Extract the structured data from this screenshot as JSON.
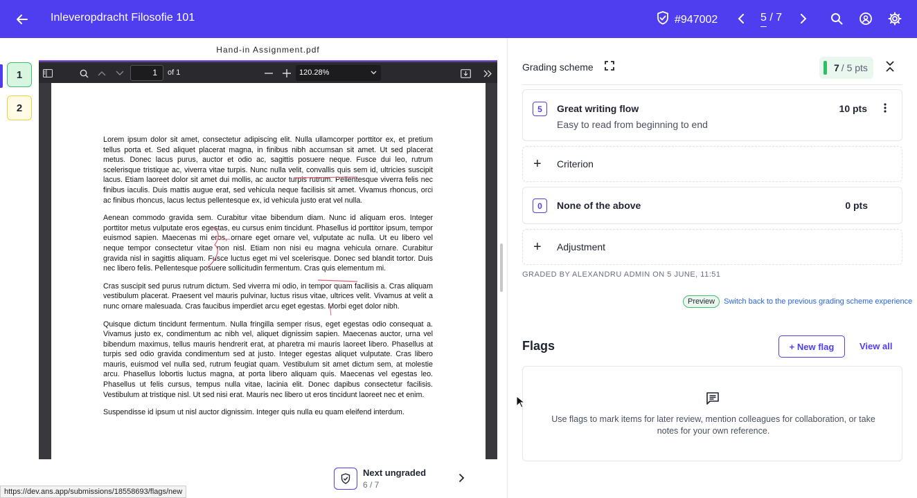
{
  "header": {
    "title": "Inleveropdracht Filosofie 101",
    "submission_id": "#947002",
    "counter_current": "5",
    "counter_total": "/ 7"
  },
  "pages": [
    {
      "label": "1"
    },
    {
      "label": "2"
    }
  ],
  "pdf": {
    "filename": "Hand-in Assignment.pdf",
    "page_number": "1",
    "of_pages": "of 1",
    "zoom": "120.28%",
    "paragraphs": [
      "Lorem ipsum dolor sit amet, consectetur adipiscing elit. Nulla ullamcorper porttitor ex, et pretium tellus porta et. Sed aliquet placerat magna, in finibus nibh accumsan sit amet. Ut sed placerat metus. Donec lacus purus, auctor et odio ac, sagittis posuere neque. Fusce dui leo, rutrum scelerisque tristique ac, viverra vitae turpis. Nunc nulla velit, convallis quis sem id, ultricies suscipit lacus. Etiam laoreet dolor sit amet dui mollis, ac auctor turpis rutrum. Pellentesque viverra felis nec finibus iaculis. Duis mattis augue erat, sed vehicula neque facilisis sit amet. Vivamus rhoncus, orci ac finibus rhoncus, lacus lectus pellentesque ex, id vehicula justo erat vel nulla.",
      "Aenean commodo gravida sem. Curabitur vitae bibendum diam. Nunc id aliquam eros. Integer porttitor metus vulputate eros egestas, eu cursus enim tincidunt. Phasellus id porttitor ipsum, tempor euismod sapien. Maecenas mi eros, ornare eget ornare vel, vulputate ac nulla. Ut eu libero vel neque tempor consectetur vitae non nisl. Etiam non nisi eu magna vehicula ornare. Curabitur gravida nisl in sagittis aliquam. Fusce luctus eget mi vel scelerisque. Donec sed blandit tortor. Duis nec libero felis. Pellentesque posuere sollicitudin fermentum. Cras quis elementum mi.",
      "Cras suscipit sed purus rutrum dictum. Sed viverra mi odio, in tempor quam facilisis a. Cras aliquam vestibulum placerat. Praesent vel mauris pulvinar, luctus risus vitae, ultrices velit. Vivamus at velit a nunc ornare malesuada. Cras faucibus imperdiet arcu eget egestas. Morbi eget dolor nibh.",
      "Quisque dictum tincidunt fermentum. Nulla fringilla semper risus, eget egestas odio consequat a. Vivamus justo ex, condimentum ac nibh vel, aliquet dignissim sapien. Maecenas auctor, urna vel bibendum maximus, tellus mauris hendrerit erat, at pharetra mi mauris laoreet libero. Phasellus at turpis sed odio gravida condimentum sed at justo. Integer egestas aliquet vulputate. Cras libero mauris, euismod vel nulla sed, rutrum feugiat quam. Vestibulum sit amet dictum sem, at molestie arcu. Phasellus lobortis luctus magna, at porta libero aliquam quis. Maecenas vel egestas leo. Phasellus ut felis cursus, tempus nulla vitae, lacinia elit. Donec dapibus consectetur facilisis. Vestibulum at tristique nisl. Ut sed nisi erat. Mauris nec libero ut eros tincidunt laoreet nec et enim.",
      "Suspendisse id ipsum ut nisl auctor dignissim. Integer quis nulla eu quam eleifend interdum."
    ]
  },
  "next_ungraded": {
    "label": "Next ungraded",
    "count": "6 / 7"
  },
  "status_url": "https://dev.ans.app/submissions/18558693/flags/new",
  "grading": {
    "title": "Grading scheme",
    "score": "7",
    "score_rest": "/ 5 pts",
    "criteria": [
      {
        "number": "5",
        "title": "Great writing flow",
        "description": "Easy to read from beginning to end",
        "points": "10 pts"
      },
      {
        "number": "0",
        "title": "None of the above",
        "points": "0 pts"
      }
    ],
    "add_criterion": "Criterion",
    "add_adjustment": "Adjustment",
    "graded_by": "GRADED BY ALEXANDRU ADMIN ON 5 JUNE, 11:51",
    "preview_tag": "Preview",
    "switch_link": "Switch back to the previous grading scheme experience"
  },
  "flags": {
    "title": "Flags",
    "new_flag": "+ New flag",
    "view_all": "View all",
    "empty_message": "Use flags to mark items for later review, mention colleagues for collaboration, or take notes for your own reference."
  },
  "colors": {
    "brand": "#4f3ef0",
    "success": "#2cc065",
    "link": "#2563eb"
  }
}
